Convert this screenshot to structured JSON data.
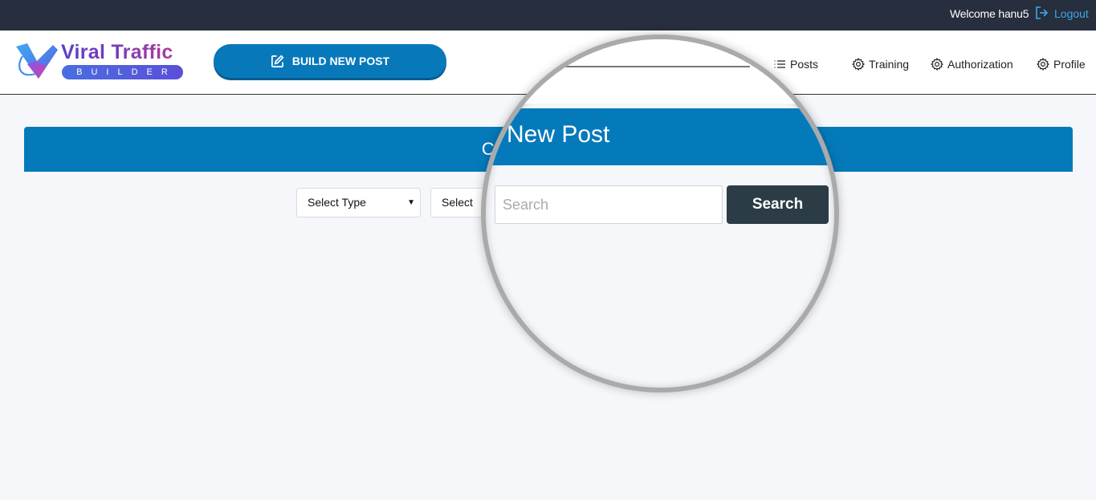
{
  "topbar": {
    "welcome_text": "Welcome hanu5",
    "logout_label": "Logout",
    "logout_icon": "sign-out-icon",
    "colors": {
      "background": "#272e3d",
      "link": "#3ea8e6"
    }
  },
  "header": {
    "logo": {
      "title": "Viral Traffic",
      "subtitle": "BUILDER"
    },
    "build_button_label": "BUILD NEW POST",
    "build_button_icon": "edit-icon",
    "nav": [
      {
        "label": "Posts",
        "icon": "list-icon"
      },
      {
        "label": "Training",
        "icon": "gear-icon"
      },
      {
        "label": "Authorization",
        "icon": "gear-icon"
      },
      {
        "label": "Profile",
        "icon": "gear-icon"
      }
    ],
    "colors": {
      "accent": "#0779ba"
    }
  },
  "content": {
    "banner_title": "Create New Post",
    "banner_partial_visible": "C",
    "filters": {
      "type_select": {
        "value": "Select Type"
      },
      "second_select": {
        "value": "Select"
      }
    },
    "colors": {
      "banner": "#047abb",
      "background": "#f5f7fa"
    }
  },
  "magnifier": {
    "title": "New Post",
    "search_placeholder": "Search",
    "search_button_label": "Search",
    "colors": {
      "button": "#2b3c46",
      "ring": "#aaaaaa"
    }
  }
}
